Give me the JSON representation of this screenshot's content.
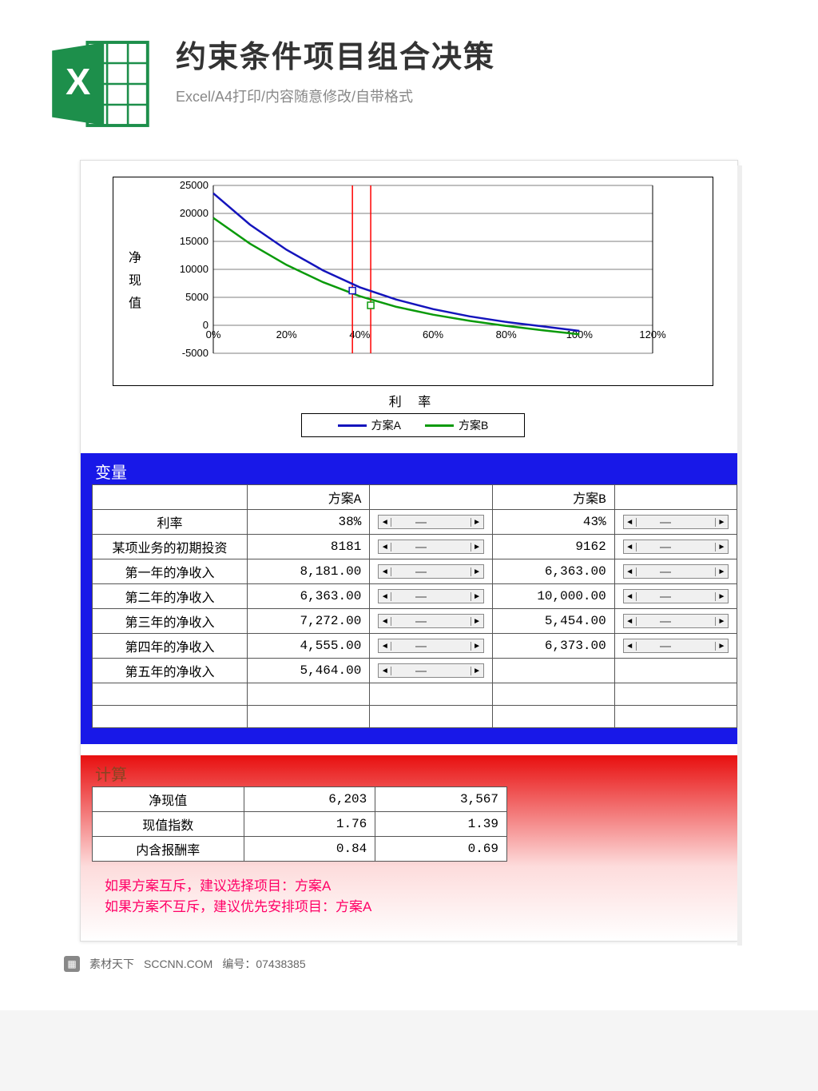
{
  "header": {
    "title": "约束条件项目组合决策",
    "subtitle": "Excel/A4打印/内容随意修改/自带格式"
  },
  "chart_data": {
    "type": "line",
    "ylabel": "净 现 值",
    "xlabel": "利  率",
    "xlim": [
      0,
      1.2
    ],
    "ylim": [
      -5000,
      25000
    ],
    "x_ticks": [
      "0%",
      "20%",
      "40%",
      "60%",
      "80%",
      "100%",
      "120%"
    ],
    "y_ticks": [
      -5000,
      0,
      5000,
      10000,
      15000,
      20000,
      25000
    ],
    "markers": [
      {
        "series": "方案A",
        "x": 0.38,
        "y": 6203
      },
      {
        "series": "方案B",
        "x": 0.43,
        "y": 3567
      }
    ],
    "series": [
      {
        "name": "方案A",
        "color": "#1414bc",
        "x": [
          0,
          0.1,
          0.2,
          0.3,
          0.4,
          0.5,
          0.6,
          0.7,
          0.8,
          0.9,
          1.0
        ],
        "y": [
          23600,
          18000,
          13500,
          9800,
          6800,
          4600,
          2900,
          1600,
          600,
          -200,
          -1000
        ]
      },
      {
        "name": "方案B",
        "color": "#0a9a0a",
        "x": [
          0,
          0.1,
          0.2,
          0.3,
          0.4,
          0.5,
          0.6,
          0.7,
          0.8,
          0.9,
          1.0
        ],
        "y": [
          19200,
          14600,
          10800,
          7700,
          5200,
          3300,
          1900,
          800,
          -100,
          -900,
          -1600
        ]
      }
    ]
  },
  "variables": {
    "section_title": "变量",
    "col_a": "方案A",
    "col_b": "方案B",
    "rows": [
      {
        "label": "利率",
        "a": "38%",
        "b": "43%",
        "a_scroll": true,
        "b_scroll": true
      },
      {
        "label": "某项业务的初期投资",
        "a": "8181",
        "b": "9162",
        "a_scroll": true,
        "b_scroll": true
      },
      {
        "label": "第一年的净收入",
        "a": "8,181.00",
        "b": "6,363.00",
        "a_scroll": true,
        "b_scroll": true
      },
      {
        "label": "第二年的净收入",
        "a": "6,363.00",
        "b": "10,000.00",
        "a_scroll": true,
        "b_scroll": true
      },
      {
        "label": "第三年的净收入",
        "a": "7,272.00",
        "b": "5,454.00",
        "a_scroll": true,
        "b_scroll": true
      },
      {
        "label": "第四年的净收入",
        "a": "4,555.00",
        "b": "6,373.00",
        "a_scroll": true,
        "b_scroll": true
      },
      {
        "label": "第五年的净收入",
        "a": "5,464.00",
        "b": "",
        "a_scroll": true,
        "b_scroll": false
      },
      {
        "label": "",
        "a": "",
        "b": "",
        "a_scroll": false,
        "b_scroll": false
      },
      {
        "label": "",
        "a": "",
        "b": "",
        "a_scroll": false,
        "b_scroll": false
      }
    ]
  },
  "calc": {
    "section_title": "计算",
    "rows": [
      {
        "label": "净现值",
        "a": "6,203",
        "b": "3,567"
      },
      {
        "label": "现值指数",
        "a": "1.76",
        "b": "1.39"
      },
      {
        "label": "内含报酬率",
        "a": "0.84",
        "b": "0.69"
      }
    ]
  },
  "advice": {
    "line1": "如果方案互斥，建议选择项目：方案A",
    "line2": "如果方案不互斥，建议优先安排项目：方案A"
  },
  "footer": {
    "brand": "素材天下",
    "site": "SCCNN.COM",
    "code_label": "编号：",
    "code": "07438385"
  }
}
